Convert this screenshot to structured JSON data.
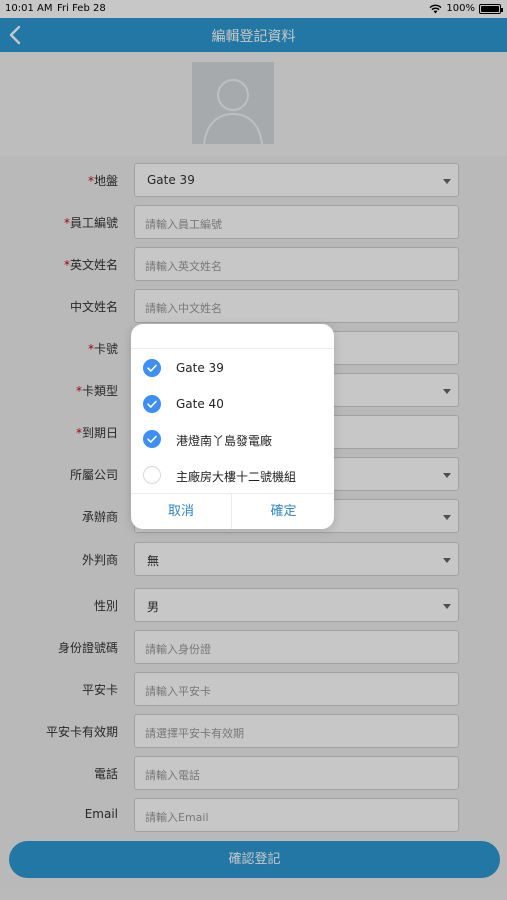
{
  "status_bar": {
    "time": "10:01 AM",
    "date": "Fri Feb 28",
    "battery": "100%"
  },
  "header": {
    "title": "編輯登記資料"
  },
  "form": {
    "site": {
      "label": "地盤",
      "required_mark": "*",
      "value": "Gate 39"
    },
    "employee_no": {
      "label": "員工編號",
      "required_mark": "*",
      "placeholder": "請輸入員工編號"
    },
    "english_name": {
      "label": "英文姓名",
      "required_mark": "*",
      "placeholder": "請輸入英文姓名"
    },
    "chinese_name": {
      "label": "中文姓名",
      "placeholder": "請輸入中文姓名"
    },
    "card_no": {
      "label": "卡號",
      "required_mark": "*"
    },
    "card_type": {
      "label": "卡類型",
      "required_mark": "*"
    },
    "expiry_date": {
      "label": "到期日",
      "required_mark": "*"
    },
    "company": {
      "label": "所屬公司"
    },
    "contractor": {
      "label": "承辦商"
    },
    "subcontractor": {
      "label": "外判商",
      "value": "無"
    },
    "gender": {
      "label": "性別",
      "value": "男"
    },
    "id_no": {
      "label": "身份證號碼",
      "placeholder": "請輸入身份證"
    },
    "safety_card": {
      "label": "平安卡",
      "placeholder": "請輸入平安卡"
    },
    "safety_card_expiry": {
      "label": "平安卡有效期",
      "placeholder": "請選擇平安卡有效期"
    },
    "phone": {
      "label": "電話",
      "placeholder": "請輸入電話"
    },
    "email": {
      "label": "Email",
      "placeholder": "請輸入Email"
    }
  },
  "submit_label": "確認登記",
  "dialog": {
    "options": [
      {
        "label": "Gate 39",
        "checked": true
      },
      {
        "label": "Gate 40",
        "checked": true
      },
      {
        "label": "港燈南丫島發電廠",
        "checked": true
      },
      {
        "label": "主廠房大樓十二號機組",
        "checked": false
      }
    ],
    "cancel_label": "取消",
    "ok_label": "確定"
  },
  "colors": {
    "primary": "#2e99d2",
    "checkbox_on": "#3e8ff5",
    "required": "#d0021b"
  }
}
